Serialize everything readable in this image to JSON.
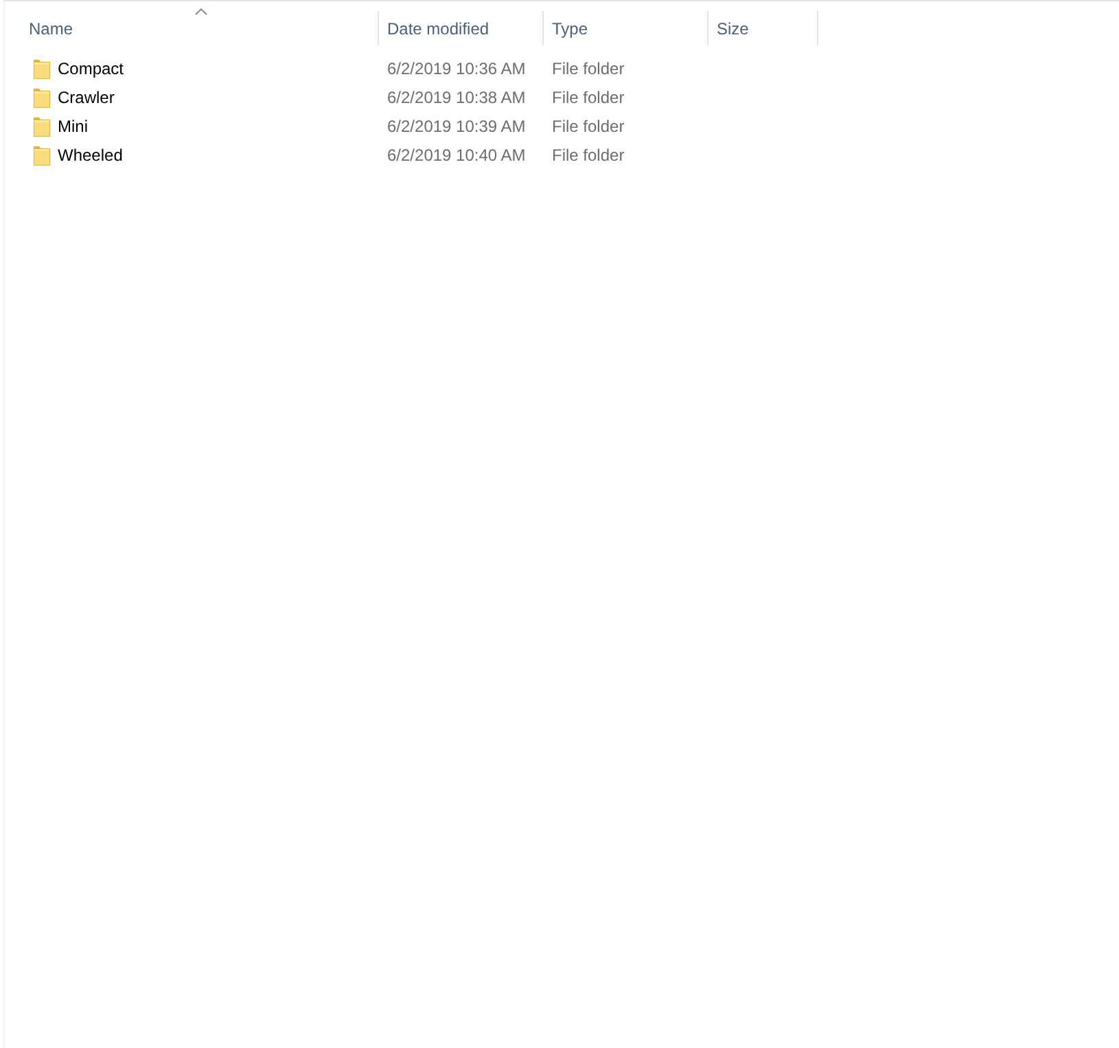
{
  "columns": [
    {
      "label": "Name",
      "sorted": true
    },
    {
      "label": "Date modified",
      "sorted": false
    },
    {
      "label": "Type",
      "sorted": false
    },
    {
      "label": "Size",
      "sorted": false
    }
  ],
  "rows": [
    {
      "name": "Compact",
      "date_modified": "6/2/2019 10:36 AM",
      "type": "File folder"
    },
    {
      "name": "Crawler",
      "date_modified": "6/2/2019 10:38 AM",
      "type": "File folder"
    },
    {
      "name": "Mini",
      "date_modified": "6/2/2019 10:39 AM",
      "type": "File folder"
    },
    {
      "name": "Wheeled",
      "date_modified": "6/2/2019 10:40 AM",
      "type": "File folder"
    }
  ]
}
